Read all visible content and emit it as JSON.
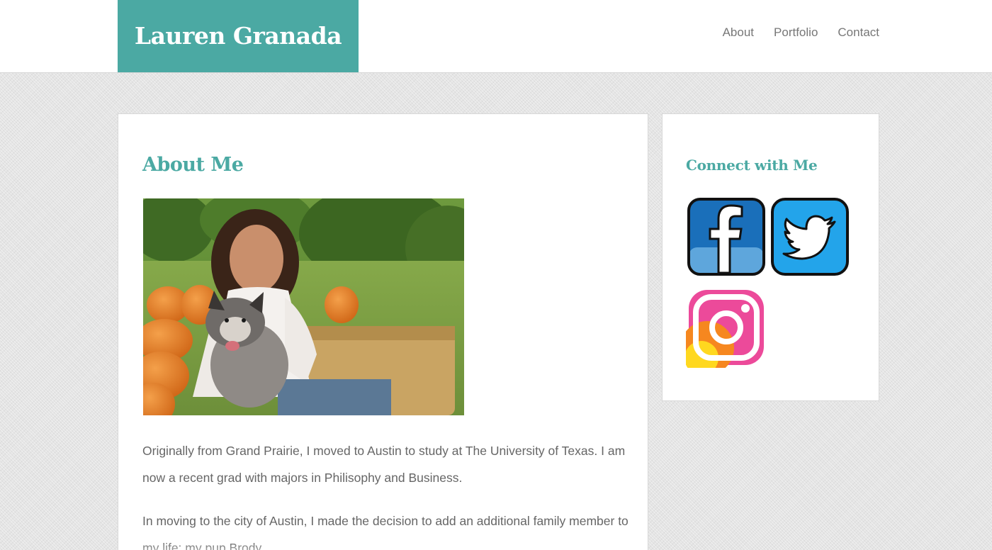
{
  "header": {
    "site_title": "Lauren Granada",
    "nav": [
      {
        "label": "About"
      },
      {
        "label": "Portfolio"
      },
      {
        "label": "Contact"
      }
    ]
  },
  "main": {
    "heading": "About Me",
    "photo_alt": "Lauren with her dog in a pumpkin patch",
    "paragraphs": [
      "Originally from Grand Prairie, I moved to Austin to study at The University of Texas. I am now a recent grad with majors in Philisophy and Business.",
      "In moving to the city of Austin, I made the decision to add an additional family member to my life: my pup Brody."
    ]
  },
  "sidebar": {
    "heading": "Connect with Me",
    "social": [
      {
        "name": "facebook-icon",
        "label": "Facebook"
      },
      {
        "name": "twitter-icon",
        "label": "Twitter"
      },
      {
        "name": "instagram-icon",
        "label": "Instagram"
      }
    ]
  },
  "colors": {
    "brand": "#4ba9a3",
    "text": "#666666",
    "nav": "#777777",
    "background": "#e4e4e4"
  }
}
